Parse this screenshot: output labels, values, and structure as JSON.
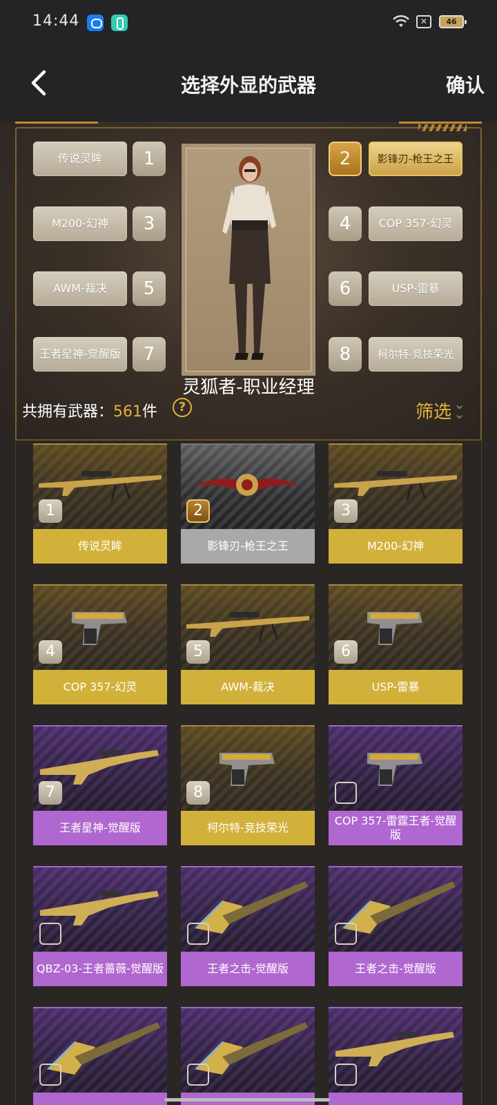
{
  "status_bar": {
    "time": "14:44",
    "battery": "46"
  },
  "header": {
    "title": "选择外显的武器",
    "confirm": "确认"
  },
  "slots_left": [
    {
      "label": "传说灵眸",
      "num": "1"
    },
    {
      "label": "M200-幻神",
      "num": "3"
    },
    {
      "label": "AWM-裁决",
      "num": "5"
    },
    {
      "label": "王者星神-觉醒版",
      "num": "7"
    }
  ],
  "slots_right": [
    {
      "label": "影锋刃-枪王之王",
      "num": "2",
      "active": true
    },
    {
      "label": "COP 357-幻灵",
      "num": "4"
    },
    {
      "label": "USP-雷暴",
      "num": "6"
    },
    {
      "label": "柯尔特-竞技荣光",
      "num": "8"
    }
  ],
  "character": {
    "name": "灵狐者-职业经理"
  },
  "summary": {
    "owned_label": "共拥有武器：",
    "owned_count": "561",
    "owned_unit": "件",
    "help": "?",
    "filter": "筛选",
    "filter_icon": "chevron-double-down-icon"
  },
  "weapons": [
    {
      "name": "传说灵眸",
      "badge": "1",
      "tier": "gold",
      "icon": "sniper-rifle-icon"
    },
    {
      "name": "影锋刃-枪王之王",
      "badge": "2",
      "tier": "silver",
      "selected": true,
      "icon": "blade-icon"
    },
    {
      "name": "M200-幻神",
      "badge": "3",
      "tier": "gold",
      "icon": "sniper-rifle-icon"
    },
    {
      "name": "COP 357-幻灵",
      "badge": "4",
      "tier": "gold",
      "icon": "pistol-icon"
    },
    {
      "name": "AWM-裁决",
      "badge": "5",
      "tier": "gold",
      "icon": "sniper-rifle-icon"
    },
    {
      "name": "USP-雷暴",
      "badge": "6",
      "tier": "gold",
      "icon": "pistol-icon"
    },
    {
      "name": "王者星神-觉醒版",
      "badge": "7",
      "tier": "purple",
      "icon": "rifle-icon"
    },
    {
      "name": "柯尔特-竞技荣光",
      "badge": "8",
      "tier": "gold",
      "icon": "pistol-icon"
    },
    {
      "name": "COP 357-雷霆王者-觉醒版",
      "badge": "",
      "tier": "purple",
      "icon": "pistol-icon"
    },
    {
      "name": "QBZ-03-王者蔷薇-觉醒版",
      "badge": "",
      "tier": "purple",
      "icon": "rifle-icon"
    },
    {
      "name": "王者之击-觉醒版",
      "badge": "",
      "tier": "purple",
      "icon": "axe-icon"
    },
    {
      "name": "王者之击-觉醒版",
      "badge": "",
      "tier": "purple",
      "icon": "axe-icon"
    },
    {
      "name": "",
      "badge": "",
      "tier": "purple",
      "icon": "axe-icon"
    },
    {
      "name": "",
      "badge": "",
      "tier": "purple",
      "icon": "axe-icon"
    },
    {
      "name": "",
      "badge": "",
      "tier": "purple",
      "icon": "rifle-icon"
    }
  ],
  "colors": {
    "gold_label": "#d2b13b",
    "silver_label": "#a9a9ab",
    "purple_label": "#b067cf",
    "accent": "#e8b23b"
  }
}
